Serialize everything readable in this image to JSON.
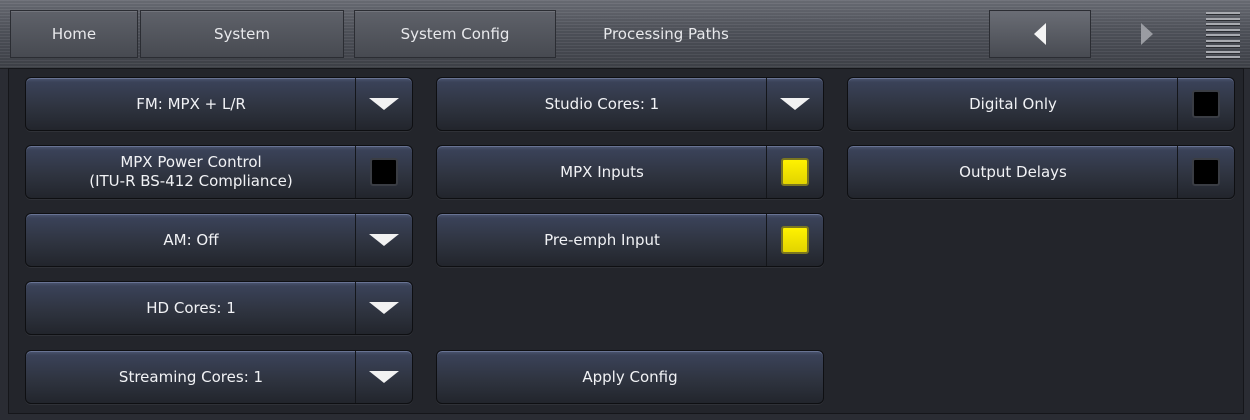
{
  "nav": {
    "home": "Home",
    "system": "System",
    "system_config": "System Config",
    "processing_paths": "Processing Paths",
    "back_icon": "arrow-left-icon",
    "forward_icon": "arrow-right-icon",
    "menu_icon": "menu-icon"
  },
  "colors": {
    "led_on": "#fff200",
    "led_off": "#000000",
    "button_top": "#4c5672"
  },
  "buttons": {
    "fm": {
      "label": "FM: MPX + L/R",
      "control": "dropdown"
    },
    "mpx_power": {
      "label_line1": "MPX Power Control",
      "label_line2": "(ITU-R BS-412 Compliance)",
      "checked": false
    },
    "am": {
      "label": "AM: Off",
      "control": "dropdown"
    },
    "hd_cores": {
      "label": "HD Cores: 1",
      "control": "dropdown"
    },
    "streaming_cores": {
      "label": "Streaming Cores: 1",
      "control": "dropdown"
    },
    "studio_cores": {
      "label": "Studio Cores: 1",
      "control": "dropdown"
    },
    "mpx_inputs": {
      "label": "MPX Inputs",
      "checked": true
    },
    "pre_emph": {
      "label": "Pre-emph Input",
      "checked": true
    },
    "apply_config": {
      "label": "Apply Config"
    },
    "digital_only": {
      "label": "Digital Only",
      "checked": false
    },
    "output_delays": {
      "label": "Output Delays",
      "checked": false
    }
  }
}
